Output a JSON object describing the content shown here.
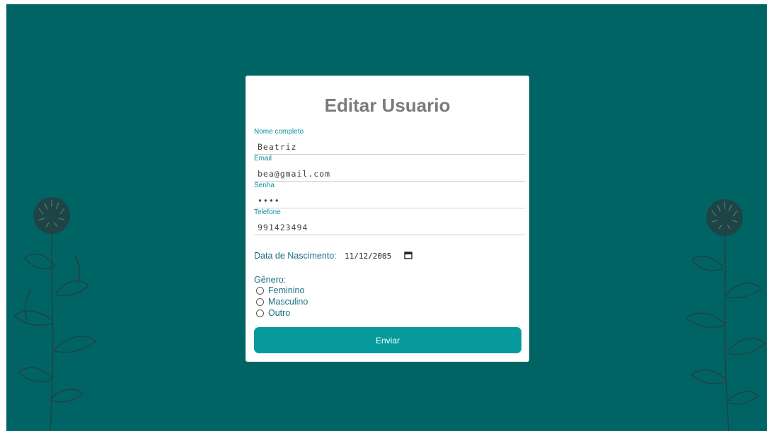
{
  "form": {
    "title": "Editar Usuario",
    "fields": [
      {
        "label": "Nome completo",
        "value": "Beatriz"
      },
      {
        "label": "Email",
        "value": "bea@gmail.com"
      },
      {
        "label": "Senha",
        "value": "••••"
      },
      {
        "label": "Telefone",
        "value": "991423494"
      }
    ],
    "birthdate": {
      "label": "Data de Nascimento:",
      "value": "11/12/2005"
    },
    "gender": {
      "label": "Gênero:",
      "options": [
        "Feminino",
        "Masculino",
        "Outro"
      ]
    },
    "submit_label": "Enviar"
  },
  "colors": {
    "background": "#016464",
    "accent": "#079a9c",
    "label": "#0b8f9a",
    "title": "#7b7b7b"
  },
  "icons": {
    "calendar": "calendar-icon",
    "decoration": "clover-flower-illustration"
  }
}
